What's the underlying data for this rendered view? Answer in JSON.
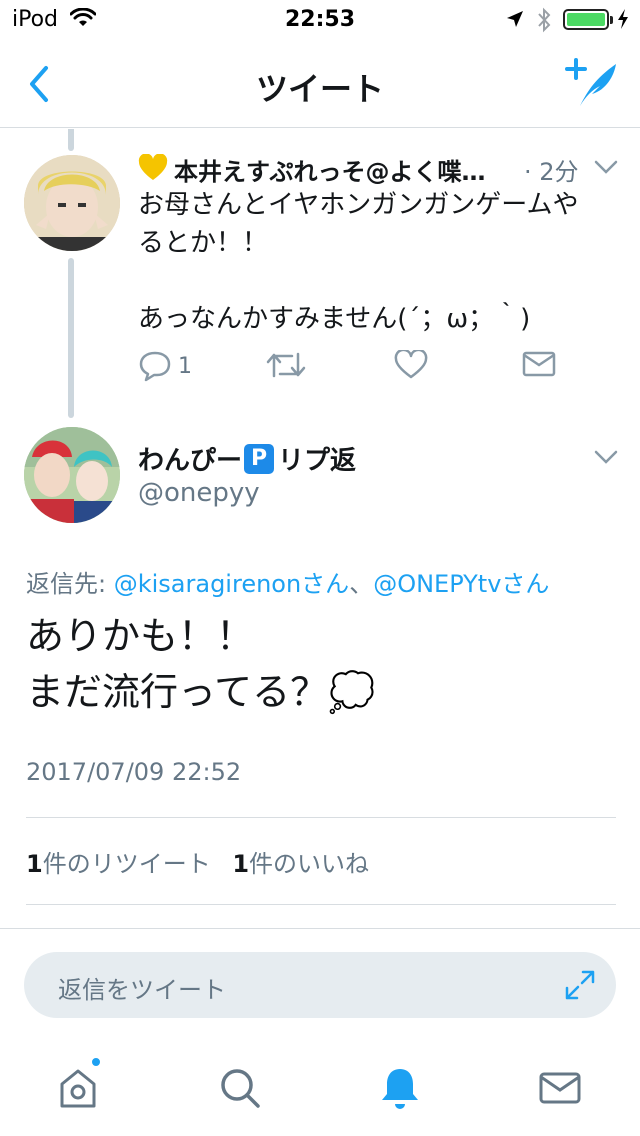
{
  "status_bar": {
    "carrier": "iPod",
    "time": "22:53"
  },
  "nav": {
    "title": "ツイート"
  },
  "tweet1": {
    "display_name": "本井えすぷれっそ@よく喋…",
    "time_ago": "· 2分",
    "lines": [
      "お母さんとイヤホンガンガンゲームや",
      "るとか！！",
      "あっなんかすみません(´；ω；｀)"
    ],
    "reply_count": "1"
  },
  "tweet2": {
    "name_before": "わんぴー",
    "name_badge": "P",
    "name_after": "リプ返",
    "handle": "@onepyy",
    "replying_prefix": "返信先: ",
    "replying_user1": "@kisaragirenonさん",
    "replying_sep": "、",
    "replying_user2": "@ONEPYtvさん",
    "text_line1": "ありかも！！",
    "text_line2": "まだ流行ってる？💭",
    "timestamp": "2017/07/09 22:52",
    "retweet_count": "1",
    "retweet_label": "件のリツイート",
    "like_count": "1",
    "like_label": "件のいいね"
  },
  "reply_box": {
    "placeholder": "返信をツイート"
  },
  "colors": {
    "accent": "#1da1f2",
    "secondary_text": "#657786",
    "divider": "#d8dde1"
  }
}
